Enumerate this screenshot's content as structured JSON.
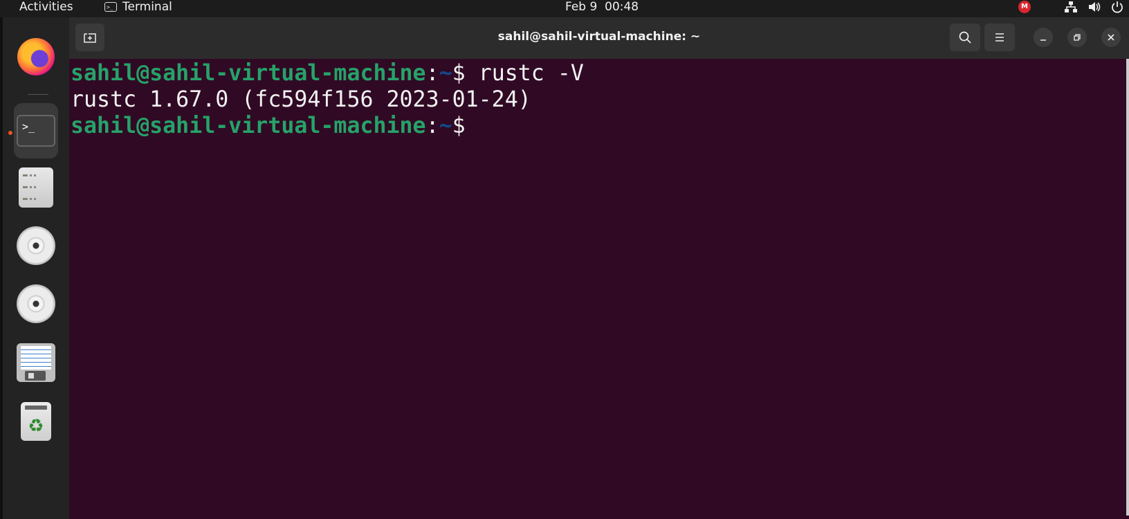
{
  "topbar": {
    "activities": "Activities",
    "app_name": "Terminal",
    "app_icon": "terminal-icon",
    "clock": "Feb 9  00:48",
    "tray": [
      "mega-icon",
      "network-icon",
      "volume-icon",
      "power-icon"
    ],
    "mega_letter": "M"
  },
  "dock": {
    "items": [
      {
        "name": "Firefox",
        "icon": "firefox-icon"
      },
      {
        "name": "Terminal",
        "icon": "terminal-icon",
        "active": true
      },
      {
        "name": "Files",
        "icon": "files-icon"
      },
      {
        "name": "Disc 1",
        "icon": "disc-icon"
      },
      {
        "name": "Disc 2",
        "icon": "disc-icon"
      },
      {
        "name": "Text Editor",
        "icon": "document-icon"
      },
      {
        "name": "Trash",
        "icon": "trash-icon"
      }
    ],
    "term_glyph": ">_",
    "recycle_glyph": "♻"
  },
  "window": {
    "title": "sahil@sahil-virtual-machine: ~",
    "buttons": [
      "new-tab-icon",
      "search-icon",
      "menu-icon",
      "minimize-icon",
      "restore-icon",
      "close-icon"
    ]
  },
  "terminal": {
    "lines": [
      {
        "user": "sahil@sahil-virtual-machine",
        "sep": ":",
        "path": "~",
        "prompt": "$",
        "command": " rustc -V"
      },
      {
        "output": "rustc 1.67.0 (fc594f156 2023-01-24)"
      },
      {
        "user": "sahil@sahil-virtual-machine",
        "sep": ":",
        "path": "~",
        "prompt": "$",
        "command": ""
      }
    ]
  },
  "colors": {
    "terminal_bg": "#300a24",
    "prompt_user": "#26a269",
    "prompt_path": "#12488b",
    "accent": "#e95420"
  }
}
